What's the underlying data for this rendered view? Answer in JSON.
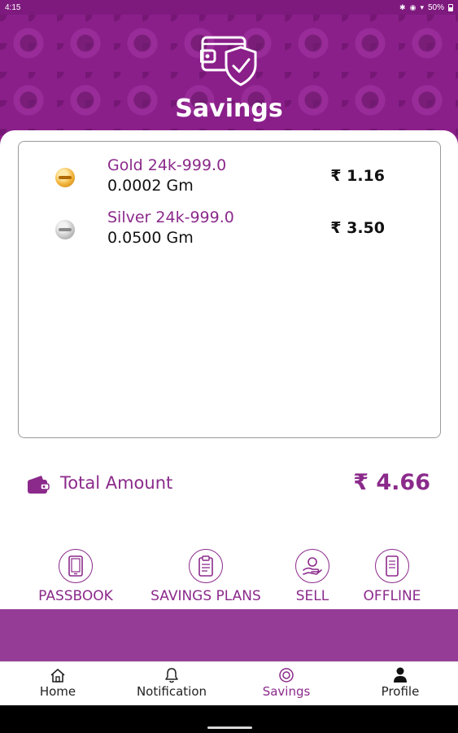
{
  "status_bar": {
    "time": "4:15",
    "battery": "50%"
  },
  "header": {
    "title": "Savings",
    "logo_icon": "wallet-shield-icon"
  },
  "holdings": [
    {
      "name": "Gold 24k-999.0",
      "quantity": "0.0002 Gm",
      "value": "₹ 1.16",
      "icon": "gold-coin-icon"
    },
    {
      "name": "Silver 24k-999.0",
      "quantity": "0.0500 Gm",
      "value": "₹ 3.50",
      "icon": "silver-coin-icon"
    }
  ],
  "total": {
    "label": "Total Amount",
    "value": "₹ 4.66",
    "icon": "wallet-icon"
  },
  "actions": [
    {
      "label": "PASSBOOK",
      "icon": "passbook-icon"
    },
    {
      "label": "SAVINGS PLANS",
      "icon": "clipboard-icon"
    },
    {
      "label": "SELL",
      "icon": "sell-hand-icon"
    },
    {
      "label": "OFFLINE",
      "icon": "offline-phone-icon"
    }
  ],
  "bottom_nav": [
    {
      "label": "Home",
      "icon": "home-icon"
    },
    {
      "label": "Notification",
      "icon": "bell-icon"
    },
    {
      "label": "Savings",
      "icon": "savings-icon",
      "active": true
    },
    {
      "label": "Profile",
      "icon": "person-icon"
    }
  ],
  "colors": {
    "brand": "#8b2a8b",
    "header_bg": "#8a1f8a",
    "banner": "#953c96"
  }
}
